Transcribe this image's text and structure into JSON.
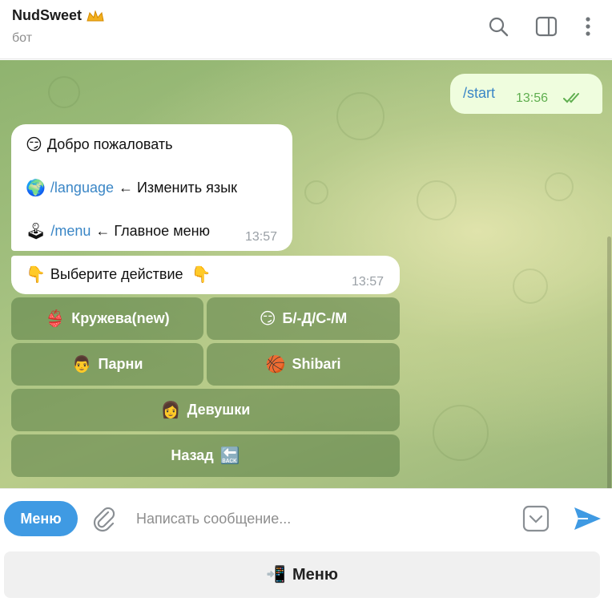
{
  "header": {
    "title": "NudSweet",
    "crown_emoji": "crown",
    "subtitle": "бот",
    "icons": [
      "search-icon",
      "sidebar-toggle-icon",
      "more-vertical-icon"
    ]
  },
  "messages": {
    "outgoing": {
      "text": "/start",
      "time": "13:56",
      "status": "read"
    },
    "welcome": {
      "line1_emoji": "😏",
      "line1_text": "Добро пожаловать",
      "line2_emoji": "🌍",
      "line2_link": "/language",
      "line2_text": "← Изменить язык",
      "line3_emoji": "🕹",
      "line3_link": "/menu",
      "line3_text": "← Главное меню",
      "time": "13:57"
    },
    "choose": {
      "emoji_left": "👇",
      "text": "Выберите действие",
      "emoji_right": "👇",
      "time": "13:57"
    }
  },
  "inline_keyboard": [
    {
      "emoji": "👙",
      "label": "Кружева(new)"
    },
    {
      "emoji": "😏",
      "label": "Б/-Д/С-/М"
    },
    {
      "emoji": "👨",
      "label": "Парни"
    },
    {
      "emoji": "🏀",
      "label": "Shibari"
    },
    {
      "emoji": "👩",
      "label": "Девушки"
    },
    {
      "emoji": "🔙",
      "label": "Назад"
    }
  ],
  "input_bar": {
    "menu_button": "Меню",
    "placeholder": "Написать сообщение..."
  },
  "reply_keyboard": {
    "emoji": "📲",
    "label": "Меню"
  },
  "colors": {
    "accent": "#3f9ae3",
    "link": "#3a86c6",
    "outgoing_bg": "#effdde",
    "read_check": "#5fae4f"
  }
}
